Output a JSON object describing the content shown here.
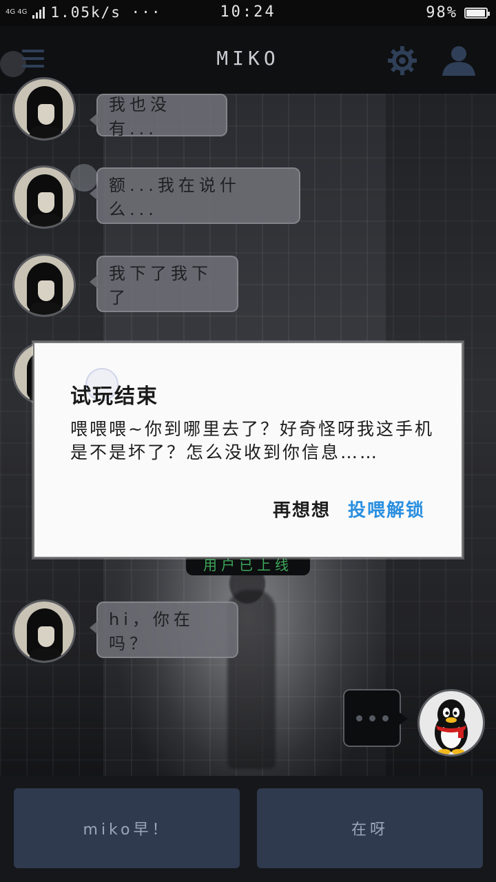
{
  "status_bar": {
    "network": "4G 4G",
    "speed": "1.05k/s ···",
    "time": "10:24",
    "battery": "98%",
    "battery_level": 0.98
  },
  "app_bar": {
    "title": "MIKO",
    "icons": [
      "menu-icon",
      "gear-icon",
      "user-icon"
    ]
  },
  "messages": [
    {
      "text": "我也没有..."
    },
    {
      "text": "额...我在说什么..."
    },
    {
      "text": "我下了我下了"
    },
    {
      "text": "hi，你在吗？"
    }
  ],
  "status_pill": "用户已上线",
  "dialog": {
    "title": "试玩结束",
    "body": "喂喂喂~你到哪里去了？好奇怪呀我这手机是不是坏了？怎么没收到你信息……",
    "cancel": "再想想",
    "confirm": "投喂解锁"
  },
  "replies": [
    "miko早！",
    "在呀"
  ],
  "colors": {
    "accent": "#2a8fe0",
    "reply_button": "#2f3a4e",
    "online_text": "#3ea85a"
  }
}
